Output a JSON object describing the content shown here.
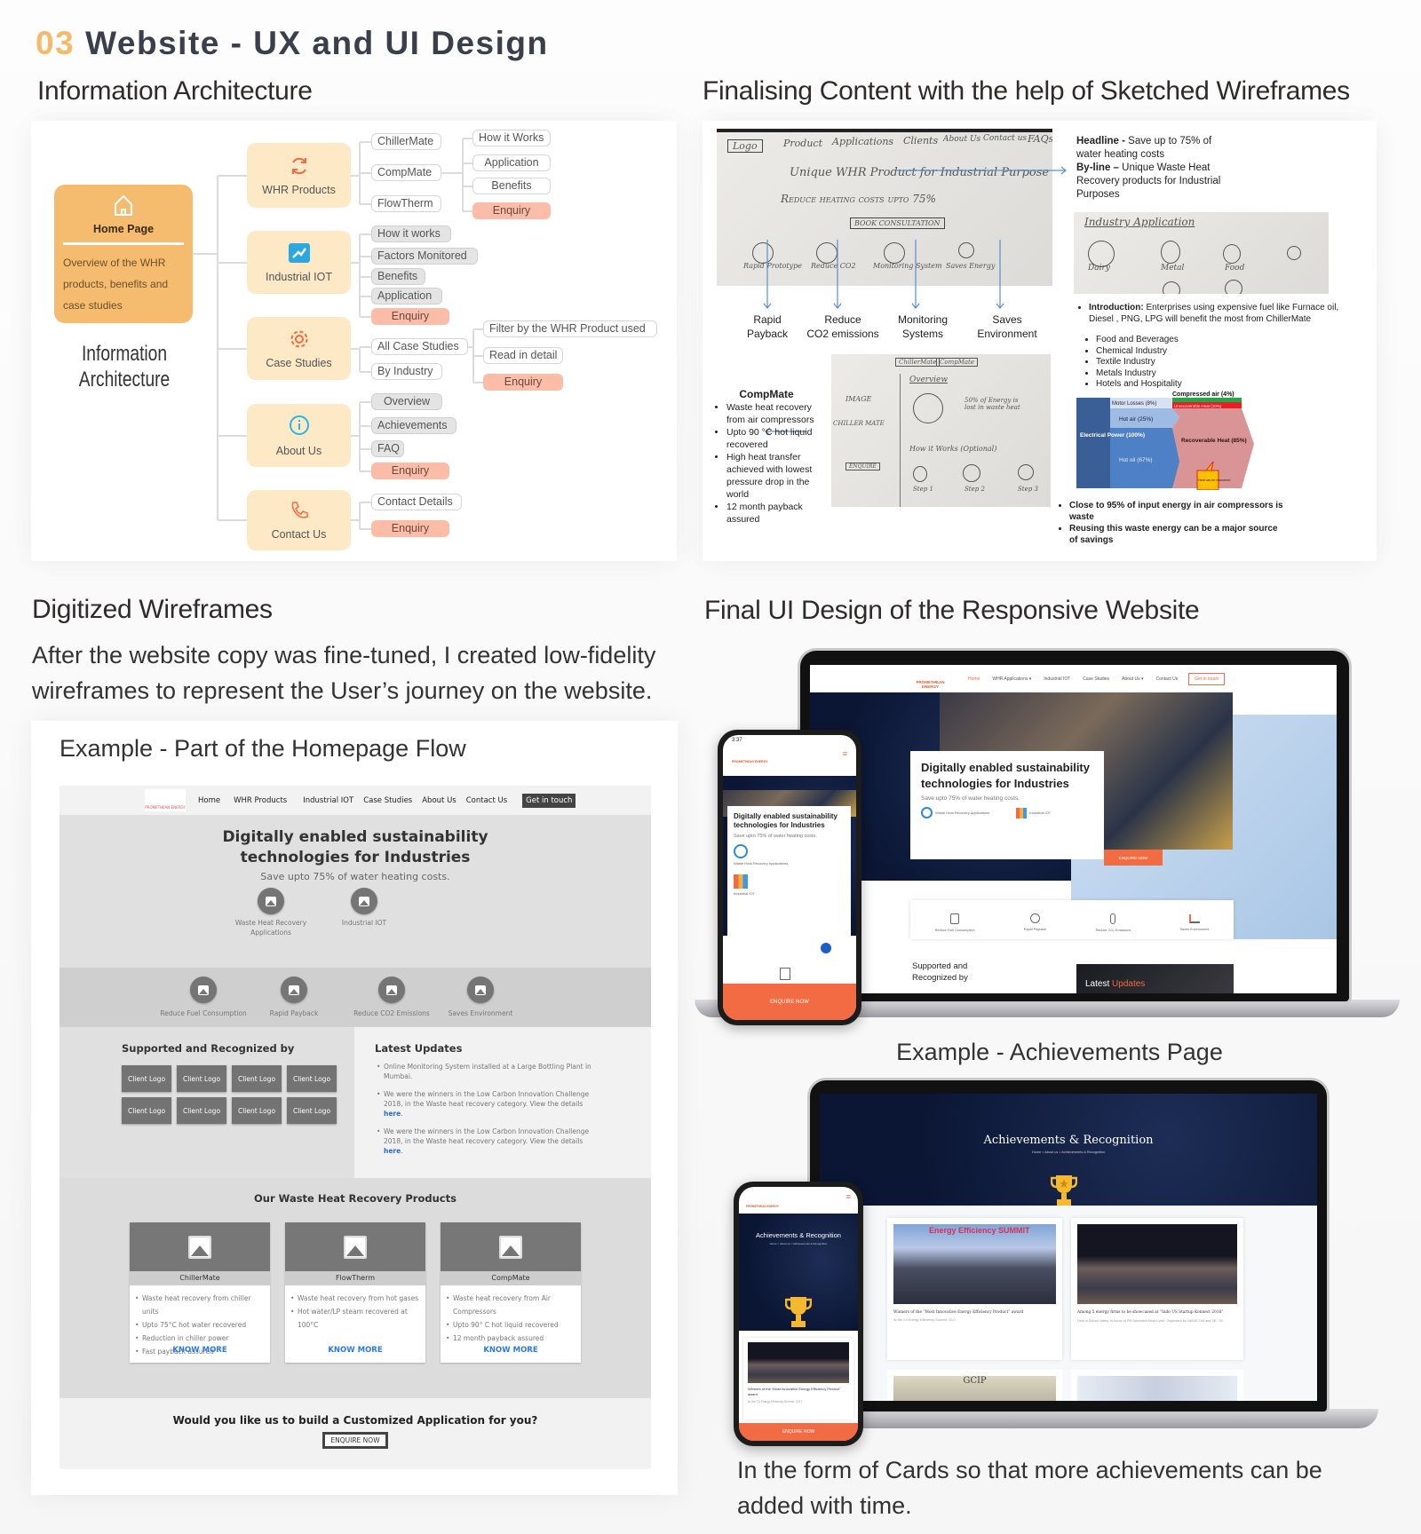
{
  "header": {
    "number": "03",
    "title": "Website - UX and UI Design"
  },
  "ia": {
    "heading": "Information Architecture",
    "home": {
      "title": "Home Page",
      "desc": "Overview of the WHR products, benefits and case studies",
      "icon": "home-icon"
    },
    "label_line1": "Information",
    "label_line2": "Architecture",
    "whr": {
      "label": "WHR Products",
      "icon": "refresh-icon",
      "children": [
        "ChillerMate",
        "CompMate",
        "FlowTherm"
      ],
      "sub": [
        "How it Works",
        "Application",
        "Benefits",
        "Enquiry"
      ]
    },
    "iot": {
      "label": "Industrial IOT",
      "icon": "chart-window-icon",
      "children": [
        "How it works",
        "Factors Monitored",
        "Benefits",
        "Application",
        "Enquiry"
      ]
    },
    "case": {
      "label": "Case Studies",
      "icon": "gear-icon",
      "children": [
        "All Case Studies",
        "By Industry"
      ],
      "sub": [
        "Filter by the WHR Product used",
        "Read in detail",
        "Enquiry"
      ]
    },
    "about": {
      "label": "About Us",
      "icon": "info-icon",
      "children": [
        "Overview",
        "Achievements",
        "FAQ",
        "Enquiry"
      ]
    },
    "contact": {
      "label": "Contact Us",
      "icon": "phone-icon",
      "children": [
        "Contact Details",
        "Enquiry"
      ]
    }
  },
  "sketch": {
    "heading": "Finalising Content with the help of Sketched Wireframes",
    "sketch1": {
      "nav": [
        "Logo",
        "Product",
        "Applications",
        "Clients",
        "About Us",
        "Contact us",
        "FAQs"
      ],
      "headline": "Unique WHR Product for Industrial Purpose",
      "sub": "Reduce heating costs upto 75%",
      "button": "Book Consultation",
      "circles": [
        "Rapid Prototype",
        "Reduce CO2",
        "Monitoring System",
        "Saves Energy"
      ]
    },
    "features": [
      {
        "l1": "Rapid",
        "l2": "Payback"
      },
      {
        "l1": "Reduce",
        "l2": "CO2 emissions"
      },
      {
        "l1": "Monitoring",
        "l2": "Systems"
      },
      {
        "l1": "Saves",
        "l2": "Environment"
      }
    ],
    "headline_label": "Headline -",
    "headline_text": "Save up to 75% of water heating costs",
    "byline_label": "By-line –",
    "byline_text": "Unique Waste Heat Recovery products for Industrial Purposes",
    "sketch2": {
      "title": "Industry Application",
      "items": [
        "Dairy",
        "Metal",
        "Food"
      ]
    },
    "intro_label": "Introduction:",
    "intro_text": "Enterprises using expensive fuel like Furnace oil, Diesel , PNG, LPG will benefit the most from ChillerMate",
    "industries": [
      "Food and Beverages",
      "Chemical Industry",
      "Textile Industry",
      "Metals Industry",
      "Hotels and Hospitality"
    ],
    "compmate": {
      "title": "CompMate",
      "bullets": [
        "Waste heat recovery from air compressors",
        "Upto 90 °C hot liquid recovered",
        "High heat transfer achieved with lowest pressure drop in the world",
        "12 month payback assured"
      ]
    },
    "sketch3": {
      "tabs": [
        "ChillerMate",
        "CompMate"
      ],
      "overview": "Overview",
      "image": "IMAGE",
      "name": "CHILLER MATE",
      "energy": "50% of Energy is lost in waste heat",
      "how": "How it Works (Optional)",
      "enquire": "ENQUIRE",
      "steps": [
        "Step 1",
        "Step 2",
        "Step 3"
      ]
    },
    "sankey": {
      "power": "Electrical Power (100%)",
      "motor": "Motor Losses (8%)",
      "hot_air": "Hot air (25%)",
      "hot_oil": "Hot oil (67%)",
      "compressed": "Compressed air (4%)",
      "unrecoverable": "Unrecoverable Heat (10%)",
      "recoverable": "Recoverable Heat (85%)",
      "callout": "Heat can be recovered",
      "colors": {
        "power": "#3a5f96",
        "hot_air": "#9dbbe3",
        "hot_oil": "#4d80c4",
        "recoverable": "#d99595",
        "compressed": "#22a84a",
        "unrecoverable": "#ee1c24",
        "callout": "#ffc000"
      }
    },
    "bottom": [
      "Close to 95% of input energy in air compressors is waste",
      "Reusing this waste energy can be a major source of savings"
    ]
  },
  "digitized": {
    "heading": "Digitized Wireframes",
    "para": "After the website copy was fine-tuned, I created low-fidelity wireframes to represent the User’s journey on the website.",
    "example": "Example - Part of the Homepage Flow",
    "wf": {
      "logo": "PROMETHEAN ENERGY",
      "nav": [
        "Home",
        "WHR Products",
        "Industrial IOT",
        "Case Studies",
        "About Us",
        "Contact Us"
      ],
      "cta": "Get in touch",
      "hero_title": "Digitally enabled sustainability technologies for Industries",
      "hero_sub": "Save upto 75% of water heating costs.",
      "hero_items": [
        "Waste Heat Recovery Applications",
        "Industrial IOT"
      ],
      "benefits": [
        "Reduce Fuel Consumption",
        "Rapid Payback",
        "Reduce CO2 Emissions",
        "Saves Environment"
      ],
      "supported_title": "Supported and Recognized by",
      "client_logo": "Client Logo",
      "updates_title": "Latest Updates",
      "updates": [
        {
          "text": "Online Monitoring System installed at a Large Bottling Plant in Mumbai."
        },
        {
          "text": "We were the winners in the Low Carbon Innovation Challenge 2018, in the Waste heat recovery category. View the details ",
          "link": "here"
        },
        {
          "text": "We were the winners in the Low Carbon Innovation Challenge 2018, in the Waste heat recovery category. View the details ",
          "link": "here"
        }
      ],
      "products_title": "Our Waste Heat Recovery Products",
      "products": [
        {
          "name": "ChillerMate",
          "bullets": [
            "Waste heat recovery from chiller units",
            "Upto 75°C hot water recovered",
            "Reduction in chiller power",
            "Fast payback assured"
          ]
        },
        {
          "name": "FlowTherm",
          "bullets": [
            "Waste heat recovery from hot gases",
            "Hot water/LP steam recovered at 100°C"
          ]
        },
        {
          "name": "CompMate",
          "bullets": [
            "Waste heat recovery from Air Compressors",
            "Upto 90° C hot liquid recovered",
            "12 month payback assured"
          ]
        }
      ],
      "know_more": "KNOW MORE",
      "cta_title": "Would you like us to build a Customized Application for you?",
      "enquire": "ENQUIRE NOW"
    }
  },
  "final": {
    "heading": "Final UI Design of the Responsive Website",
    "home": {
      "logo": "PROMETHEAN ENERGY",
      "nav": [
        "Home",
        "WHR Applications ▾",
        "Industrial IOT",
        "Case Studies",
        "About Us ▾",
        "Contact Us"
      ],
      "cta": "Get in touch",
      "title": "Digitally enabled sustainability technologies for Industries",
      "sub": "Save upto 75% of water heating costs.",
      "items": [
        "Waste Heat Recovery Applications",
        "Industrial IOT"
      ],
      "enquire": "ENQUIRE NOW",
      "benefits": [
        "Reduce Fuel Consumption",
        "Rapid Payback",
        "Reduce CO₂ Emissions",
        "Saves Environment"
      ],
      "supported": "Supported and Recognized by",
      "latest_a": "Latest ",
      "latest_b": "Updates",
      "phone_time": "3:37",
      "accent": "#f26b43"
    },
    "ach_example": "Example - Achievements Page",
    "ach": {
      "title": "Achievements & Recognition",
      "crumb": "Home > About us > Achievements & Recognition",
      "cards": [
        {
          "title": "Winners of the “Most Innovative Energy Efficiency Product” award",
          "sub": "At the CII Energy Efficiency Summit, 2017",
          "banner": "Energy Efficiency SUMMIT"
        },
        {
          "title": "Among 5 energy firms to be showcased at “Indo US Startup Konnect 2016”",
          "sub": "Held in Silicon Valley, in honor of PM Narendra Modi's visit. Organized by NASSCOM and TiE, SV"
        }
      ],
      "row2_banner": "GCIP",
      "enquire": "ENQUIRE NOW"
    },
    "caption": "In the form of Cards so that more achievements can be added with time."
  }
}
